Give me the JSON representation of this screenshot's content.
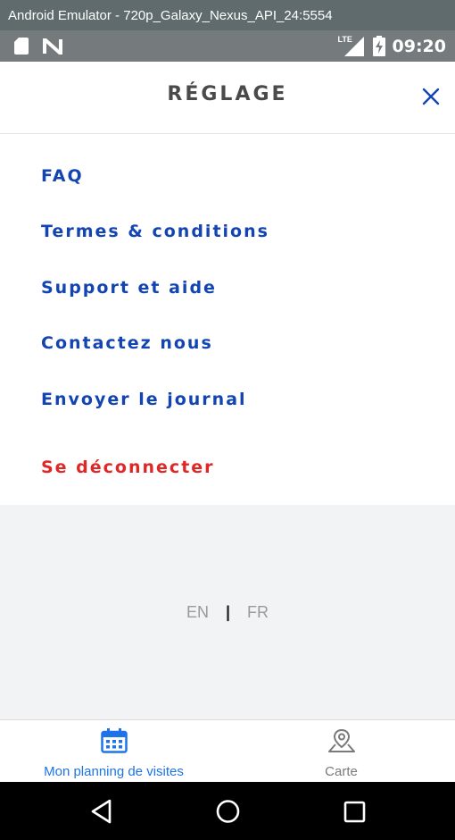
{
  "window": {
    "title": "Android Emulator - 720p_Galaxy_Nexus_API_24:5554"
  },
  "status_bar": {
    "network": "LTE",
    "time": "09:20"
  },
  "header": {
    "title": "RÉGLAGE"
  },
  "menu": {
    "items": [
      {
        "label": "FAQ"
      },
      {
        "label": "Termes & conditions"
      },
      {
        "label": "Support et aide"
      },
      {
        "label": "Contactez nous"
      },
      {
        "label": "Envoyer le journal"
      }
    ],
    "logout": "Se déconnecter"
  },
  "language": {
    "en": "EN",
    "separator": "|",
    "fr": "FR"
  },
  "bottom_nav": {
    "tabs": [
      {
        "label": "Mon planning de visites",
        "icon": "calendar-icon",
        "active": true
      },
      {
        "label": "Carte",
        "icon": "map-pin-icon",
        "active": false
      }
    ]
  },
  "colors": {
    "primary": "#1245b2",
    "danger": "#e02727",
    "active_tab": "#1e73e8",
    "inactive_tab": "#7a7a7a"
  }
}
